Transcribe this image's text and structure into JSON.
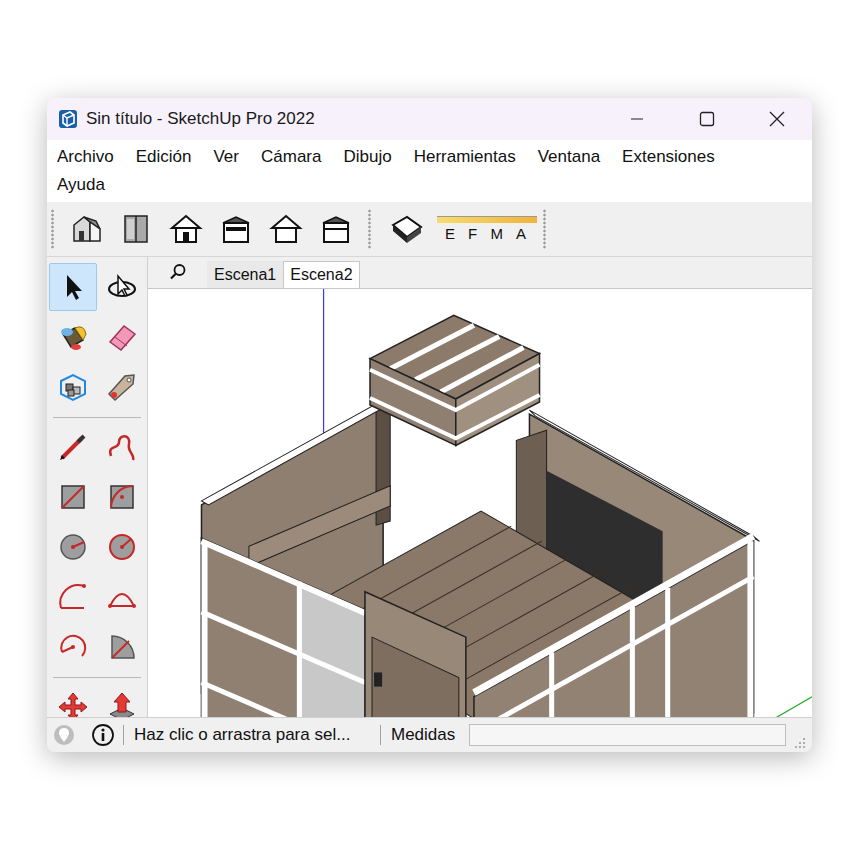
{
  "window": {
    "title": "Sin título - SketchUp Pro 2022"
  },
  "menus": [
    "Archivo",
    "Edición",
    "Ver",
    "Cámara",
    "Dibujo",
    "Herramientas",
    "Ventana",
    "Extensiones",
    "Ayuda"
  ],
  "view_buttons": [
    {
      "kind": "iso"
    },
    {
      "kind": "top"
    },
    {
      "kind": "front"
    },
    {
      "kind": "right"
    },
    {
      "kind": "back"
    },
    {
      "kind": "left"
    }
  ],
  "shadow_slider": {
    "months": [
      "E",
      "F",
      "M",
      "A"
    ]
  },
  "tool_groups": [
    [
      {
        "kind": "select",
        "selected": true
      },
      {
        "kind": "orbit",
        "selected": false
      },
      {
        "kind": "paint",
        "selected": false
      },
      {
        "kind": "eraser",
        "selected": false
      },
      {
        "kind": "component",
        "selected": false
      },
      {
        "kind": "tag",
        "selected": false
      }
    ],
    [
      {
        "kind": "pencil",
        "selected": false
      },
      {
        "kind": "freehand",
        "selected": false
      },
      {
        "kind": "rectangle",
        "selected": false
      },
      {
        "kind": "rotated-rectangle",
        "selected": false
      },
      {
        "kind": "circle",
        "selected": false
      },
      {
        "kind": "polygon",
        "selected": false
      },
      {
        "kind": "arc",
        "selected": false
      },
      {
        "kind": "two-point-arc",
        "selected": false
      },
      {
        "kind": "three-point-arc",
        "selected": false
      },
      {
        "kind": "pie",
        "selected": false
      }
    ],
    [
      {
        "kind": "move",
        "selected": false
      },
      {
        "kind": "push-pull",
        "selected": false
      }
    ]
  ],
  "scene_tabs": [
    {
      "label": "Escena1",
      "selected": false
    },
    {
      "label": "Escena2",
      "selected": true
    }
  ],
  "status_bar": {
    "hint": "Haz clic o arrastra para sel...",
    "measurements_label": "Medidas",
    "measurements_value": ""
  }
}
